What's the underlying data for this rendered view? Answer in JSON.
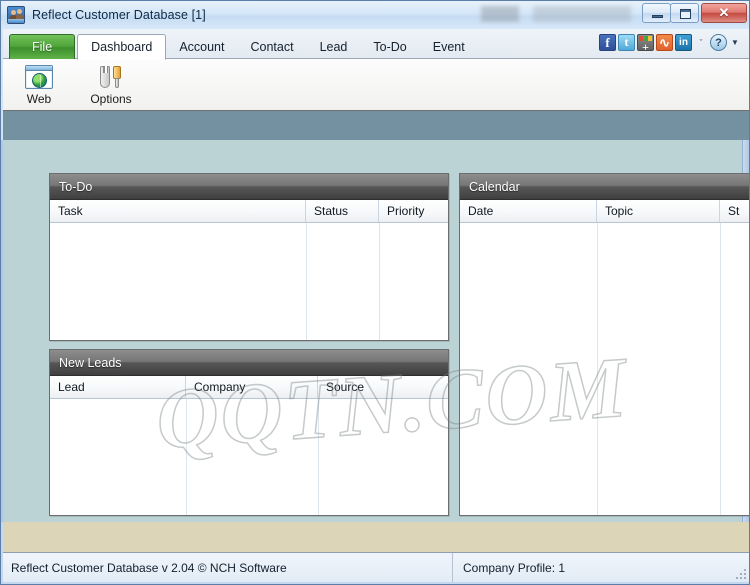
{
  "window": {
    "title": "Reflect Customer Database [1]",
    "app_icon": "people-icon",
    "controls": {
      "minimize": "minimize-icon",
      "restore": "restore-icon",
      "close": "✕"
    }
  },
  "tabs": [
    {
      "label": "File",
      "kind": "file",
      "active": false
    },
    {
      "label": "Dashboard",
      "kind": "normal",
      "active": true
    },
    {
      "label": "Account",
      "kind": "normal",
      "active": false
    },
    {
      "label": "Contact",
      "kind": "normal",
      "active": false
    },
    {
      "label": "Lead",
      "kind": "normal",
      "active": false
    },
    {
      "label": "To-Do",
      "kind": "normal",
      "active": false
    },
    {
      "label": "Event",
      "kind": "normal",
      "active": false
    }
  ],
  "social": {
    "facebook": "facebook-icon",
    "twitter": "twitter-icon",
    "share": "share-add-icon",
    "stumbleupon": "stumbleupon-icon",
    "linkedin": "linkedin-icon",
    "chevron": "ˇ",
    "help": "?",
    "caret": "▼"
  },
  "ribbon": {
    "buttons": [
      {
        "label": "Web",
        "icon": "web-browser-icon"
      },
      {
        "label": "Options",
        "icon": "tools-options-icon"
      }
    ]
  },
  "panels": {
    "todo": {
      "title": "To-Do",
      "columns": [
        "Task",
        "Status",
        "Priority"
      ],
      "rows": []
    },
    "new_leads": {
      "title": "New Leads",
      "columns": [
        "Lead",
        "Company",
        "Source"
      ],
      "rows": []
    },
    "calendar": {
      "title": "Calendar",
      "columns": [
        "Date",
        "Topic",
        "St"
      ],
      "rows": []
    }
  },
  "watermark": {
    "text": "QQTN.COM"
  },
  "statusbar": {
    "left": "Reflect Customer Database v 2.04 © NCH Software",
    "right": "Company Profile: 1"
  },
  "colors": {
    "file_tab_green": "#4ea43a",
    "band_slate": "#7491a2",
    "content_bg": "#bcd3d6",
    "tan_band": "#ddd5b8",
    "panel_header_dark": "#565656",
    "close_red": "#c44a41"
  }
}
